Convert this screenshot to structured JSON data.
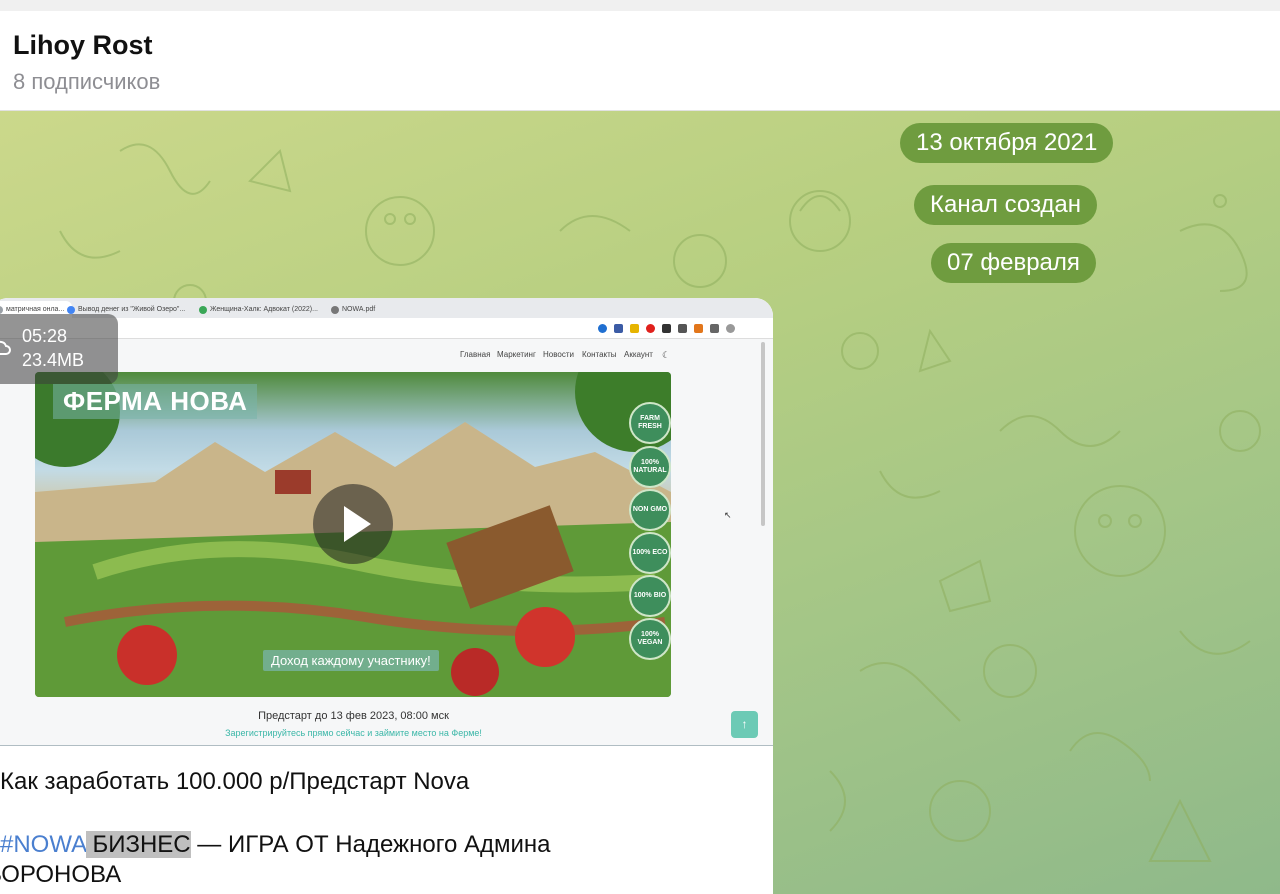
{
  "channel": {
    "title": "Lihoy Rost",
    "subscribers": "8 подписчиков"
  },
  "service_messages": {
    "date1": "13 октября 2021",
    "created": "Канал создан",
    "date2": "07 февраля"
  },
  "video": {
    "duration": "05:28",
    "size": "23.4MB",
    "browser_tabs": [
      "матричная онла...",
      "Вывод денег из \"Живой Озеро\"...",
      "Женщина-Халк: Адвокат (2022)...",
      "NOWA.pdf"
    ],
    "site_nav": [
      "Главная",
      "Маркетинг",
      "Новости",
      "Контакты",
      "Аккаунт"
    ],
    "hero_title": "ФЕРМА НОВА",
    "badges": [
      "FARM FRESH",
      "100% NATURAL",
      "NON GMO",
      "100% ECO",
      "100% BIO",
      "100% VEGAN"
    ],
    "slogan": "Доход каждому участнику!",
    "prestart": "Предстарт до 13 фев 2023, 08:00 мск",
    "register": "Зарегистрируйтесь прямо сейчас и займите место на Ферме!"
  },
  "caption": {
    "line1": "Как заработать 100.000 р/Предстарт Nova",
    "hashtag": "#NOWA",
    "highlighted": " БИЗНЕС",
    "rest": " — ИГРА ОТ Надежного Админа",
    "line3": "ВОРОНОВА"
  },
  "colors": {
    "pill_bg": "#6f9c3f",
    "hashtag": "#4a7fcf",
    "chat_bg": "#b7cf81"
  }
}
